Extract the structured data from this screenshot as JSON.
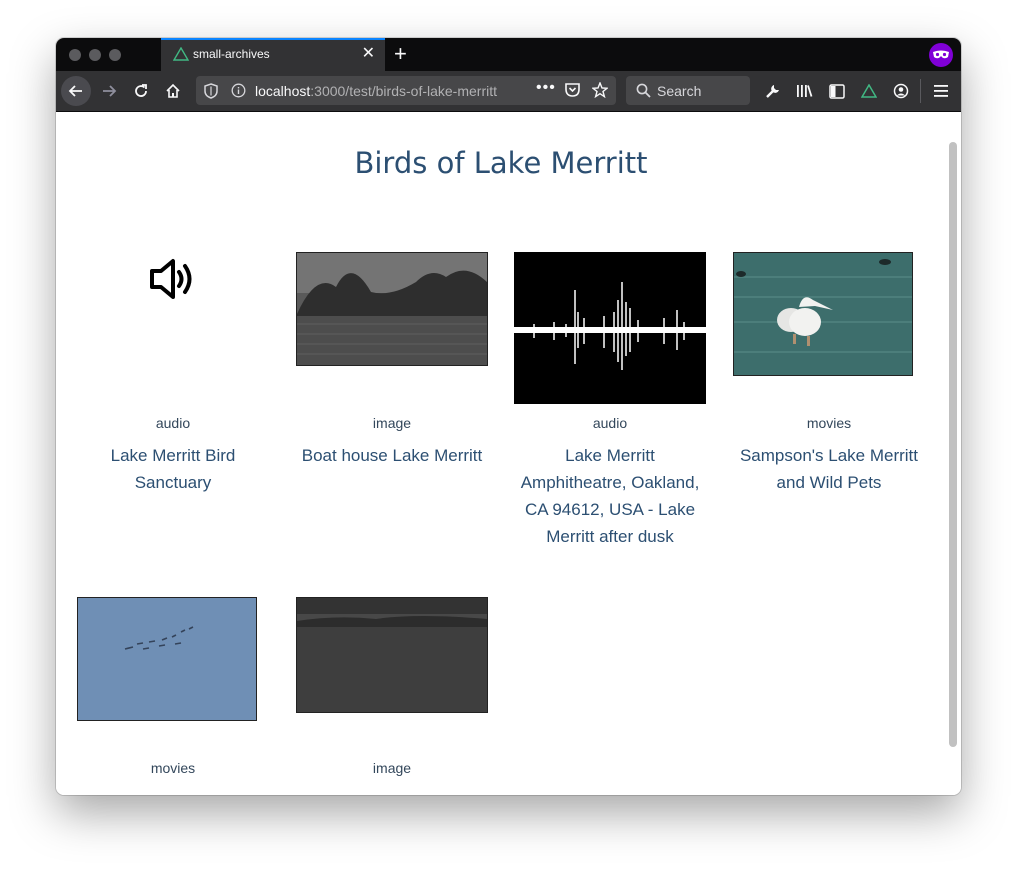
{
  "browser": {
    "tab_title": "small-archives",
    "url_host": "localhost",
    "url_rest": ":3000/test/birds-of-lake-merritt",
    "search_placeholder": "Search"
  },
  "page": {
    "title": "Birds of Lake Merritt"
  },
  "items": [
    {
      "type": "audio",
      "title": "Lake Merritt Bird Sanctuary",
      "thumb": "speaker-icon"
    },
    {
      "type": "image",
      "title": "Boat house Lake Merritt",
      "thumb": "grayscale lake photo"
    },
    {
      "type": "audio",
      "title": "Lake Merritt Amphitheatre, Oakland, CA 94612, USA - Lake Merritt after dusk",
      "thumb": "waveform"
    },
    {
      "type": "movies",
      "title": "Sampson's Lake Merritt and Wild Pets",
      "thumb": "pelicans photo"
    },
    {
      "type": "movies",
      "title": "",
      "thumb": "birds in sky"
    },
    {
      "type": "image",
      "title": "",
      "thumb": "gray lake photo"
    }
  ],
  "colors": {
    "accent": "#2c4f72",
    "tab_highlight": "#0a84ff",
    "private": "#8000d7"
  }
}
